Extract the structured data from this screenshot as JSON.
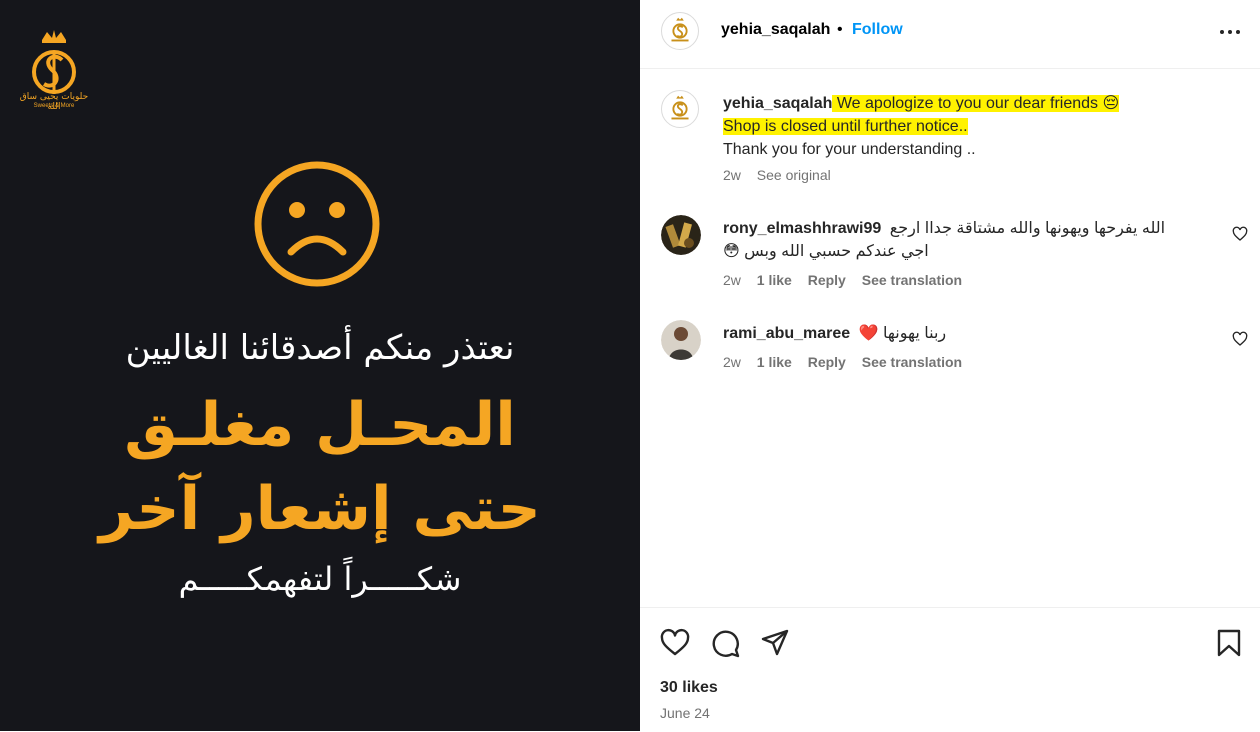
{
  "post_image": {
    "logo_text_ar": "حلويات يحيى ساق الله",
    "logo_text_en": "Sweets & More",
    "line1": "نعتذر منكم أصدقائنا الغاليين",
    "line2": "المحـل مغلـق",
    "line3": "حتى إشعار آخر",
    "line4": "شكـــــراً لتفهمكـــــم",
    "accent_color": "#f5a623",
    "bg_color": "#15161b",
    "icon": "sad-face-icon"
  },
  "header": {
    "username": "yehia_saqalah",
    "dot": "•",
    "follow_label": "Follow"
  },
  "caption": {
    "username": "yehia_saqalah",
    "line1": "We apologize to you our dear friends 😔",
    "line2": "Shop is closed until further notice..",
    "line3": "Thank you for your understanding ..",
    "time": "2w",
    "see_original": "See original"
  },
  "comments": [
    {
      "username": "rony_elmashhrawi99",
      "text_line1": "الله يفرحها ويهونها والله مشتاقة جداا ارجع",
      "text_line2": "اجي عندكم حسبي الله وبس 😳",
      "time": "2w",
      "likes": "1 like",
      "reply": "Reply",
      "translation": "See translation"
    },
    {
      "username": "rami_abu_maree",
      "text_line1": "ربنا يهونها ❤️",
      "time": "2w",
      "likes": "1 like",
      "reply": "Reply",
      "translation": "See translation"
    }
  ],
  "footer": {
    "likes": "30 likes",
    "date": "June 24"
  },
  "colors": {
    "follow": "#0095f6",
    "highlight": "#fff200",
    "meta": "#737373"
  }
}
